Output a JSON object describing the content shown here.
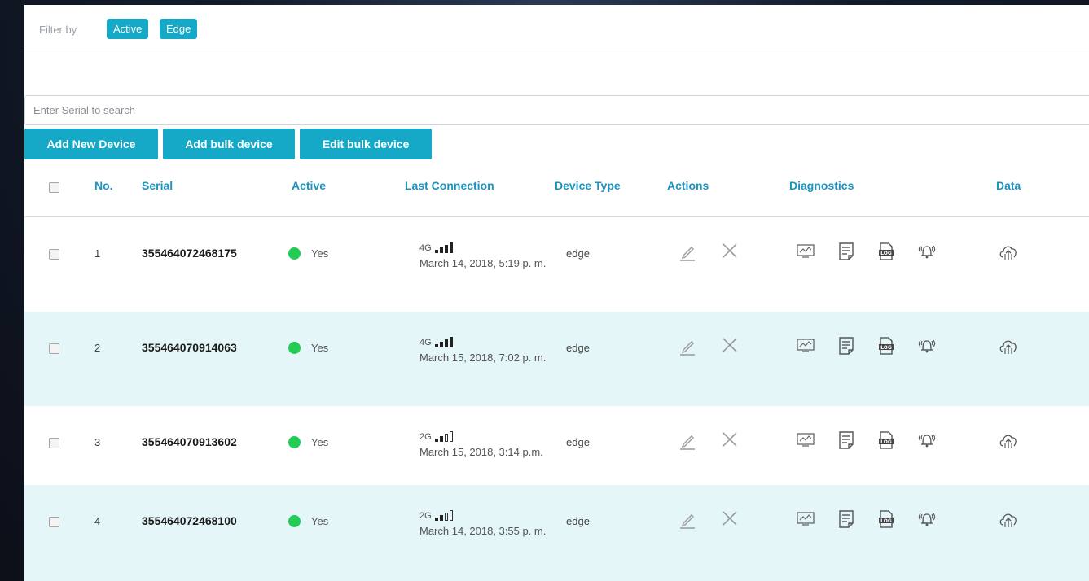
{
  "filter": {
    "label": "Filter by",
    "chips": [
      "Active",
      "Edge"
    ]
  },
  "search": {
    "placeholder": "Enter Serial to search"
  },
  "buttons": {
    "add_new": "Add New Device",
    "add_bulk": "Add bulk device",
    "edit_bulk": "Edit bulk device"
  },
  "table": {
    "headers": {
      "no": "No.",
      "serial": "Serial",
      "active": "Active",
      "last_connection": "Last Connection",
      "device_type": "Device Type",
      "actions": "Actions",
      "diagnostics": "Diagnostics",
      "data": "Data"
    },
    "rows": [
      {
        "no": "1",
        "serial": "355464072468175",
        "active": "Yes",
        "network": "4G",
        "signal_bars": 3,
        "date": "March 14, 2018, 5:19 p. m.",
        "type": "edge"
      },
      {
        "no": "2",
        "serial": "355464070914063",
        "active": "Yes",
        "network": "4G",
        "signal_bars": 3,
        "date": "March 15, 2018, 7:02 p. m.",
        "type": "edge"
      },
      {
        "no": "3",
        "serial": "355464070913602",
        "active": "Yes",
        "network": "2G",
        "signal_bars": 1,
        "date": "March 15, 2018, 3:14 p.m.",
        "type": "edge"
      },
      {
        "no": "4",
        "serial": "355464072468100",
        "active": "Yes",
        "network": "2G",
        "signal_bars": 1,
        "date": "March 14, 2018, 3:55 p. m.",
        "type": "edge"
      }
    ],
    "row_icons": {
      "actions": [
        "edit-icon",
        "delete-icon"
      ],
      "diagnostics": [
        "chart-monitor-icon",
        "report-icon",
        "log-file-icon",
        "alarm-bell-icon"
      ],
      "data": [
        "cloud-upload-icon"
      ]
    }
  },
  "colors": {
    "accent": "#16a9c7",
    "header_text": "#1b93c0",
    "alt_row": "#e4f6f8",
    "active_dot": "#22cc55"
  }
}
